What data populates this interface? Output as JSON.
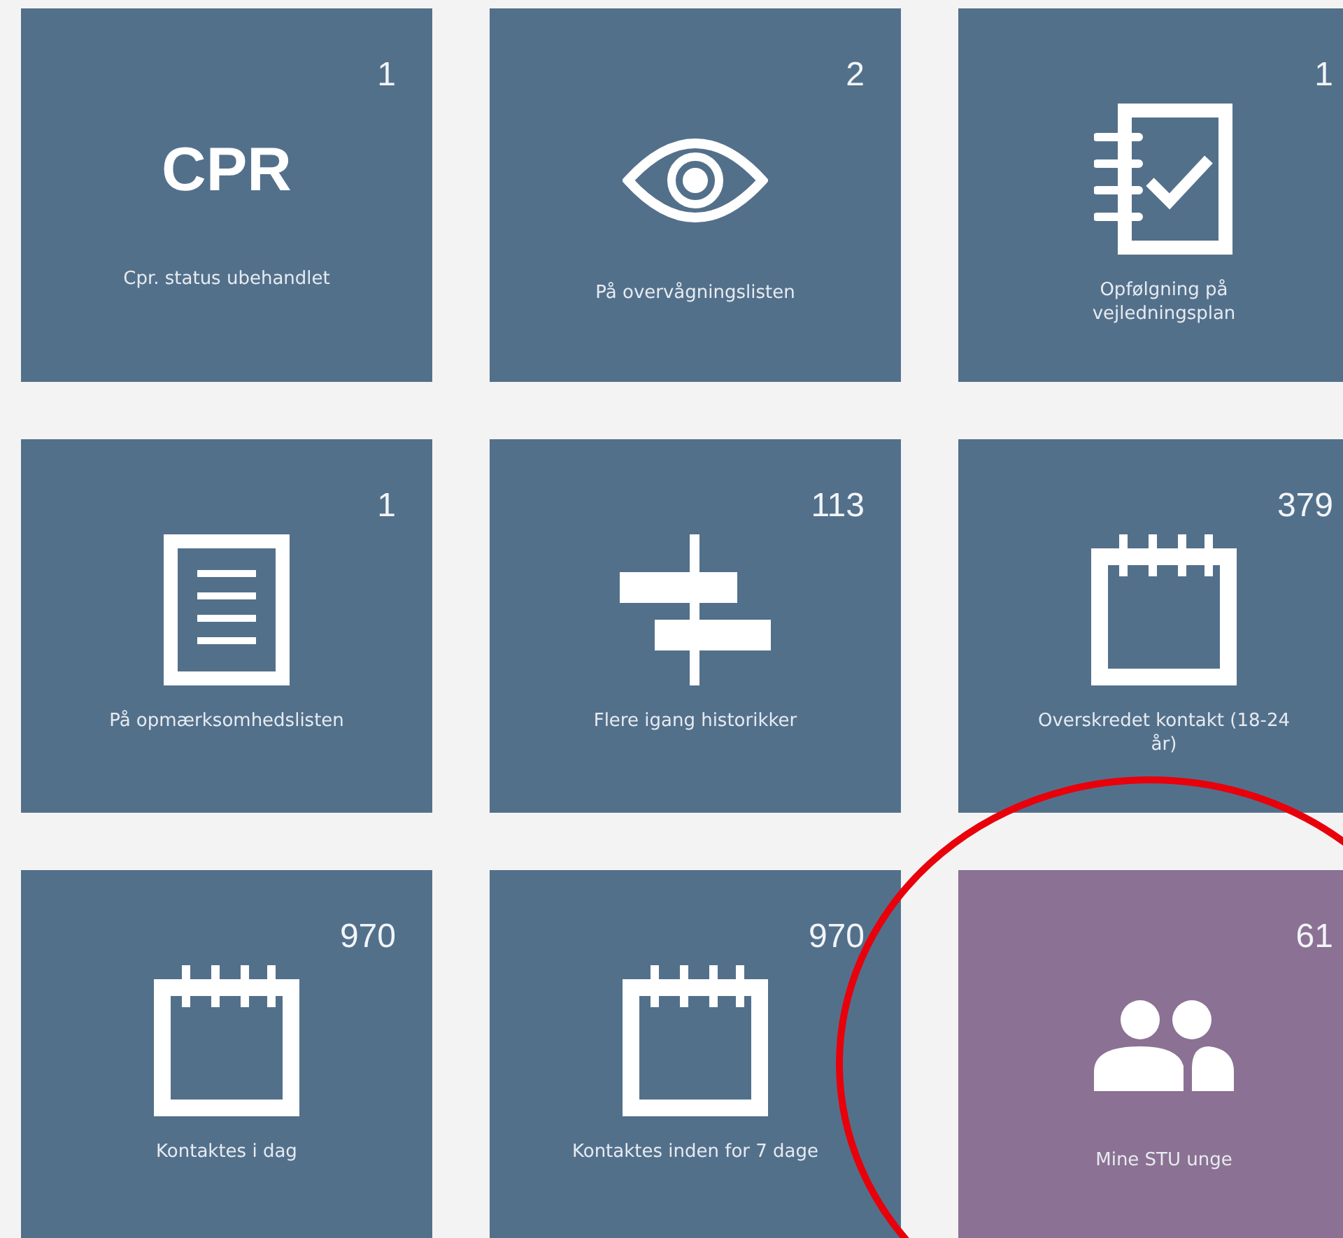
{
  "tiles": [
    {
      "count": "1",
      "kind": "cpr",
      "icon_text": "CPR",
      "label": "Cpr. status ubehandlet",
      "color": "#53708b",
      "circled": false
    },
    {
      "count": "2",
      "kind": "eye",
      "label": "På overvågningslisten",
      "color": "#53708b",
      "circled": false
    },
    {
      "count": "1",
      "kind": "notebook-check",
      "label": "Opfølgning på vejledningsplan",
      "color": "#53708b",
      "circled": false
    },
    {
      "count": "1",
      "kind": "document",
      "label": "På opmærksomhedslisten",
      "color": "#53708b",
      "circled": false
    },
    {
      "count": "113",
      "kind": "timeline",
      "label": "Flere igang historikker",
      "color": "#53708b",
      "circled": false
    },
    {
      "count": "379",
      "kind": "calendar",
      "label": "Overskredet kontakt (18-24 år)",
      "color": "#53708b",
      "circled": false
    },
    {
      "count": "970",
      "kind": "calendar",
      "label": "Kontaktes i dag",
      "color": "#53708b",
      "circled": false
    },
    {
      "count": "970",
      "kind": "calendar",
      "label": "Kontaktes inden for 7 dage",
      "color": "#53708b",
      "circled": false
    },
    {
      "count": "61",
      "kind": "people",
      "label": "Mine STU unge",
      "color": "#8b7193",
      "circled": true
    }
  ]
}
